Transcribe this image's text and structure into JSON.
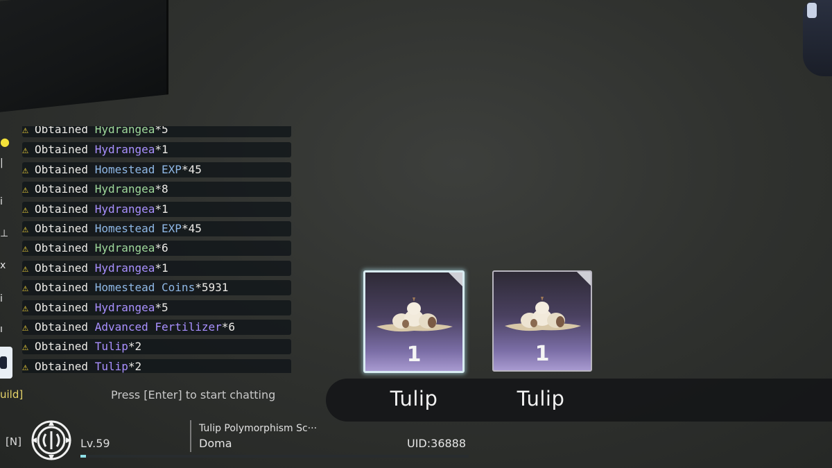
{
  "chat": {
    "hint": "Press [Enter] to start chatting",
    "guild_tag": "uild]",
    "lines": [
      {
        "prefix": "Obtained ",
        "item": "Hydrangea",
        "qty": "*5",
        "color": "green"
      },
      {
        "prefix": "Obtained ",
        "item": "Hydrangea",
        "qty": "*1",
        "color": "purple"
      },
      {
        "prefix": "Obtained ",
        "item": "Homestead EXP",
        "qty": "*45",
        "color": "blue"
      },
      {
        "prefix": "Obtained ",
        "item": "Hydrangea",
        "qty": "*8",
        "color": "green"
      },
      {
        "prefix": "Obtained ",
        "item": "Hydrangea",
        "qty": "*1",
        "color": "purple"
      },
      {
        "prefix": "Obtained ",
        "item": "Homestead EXP",
        "qty": "*45",
        "color": "blue"
      },
      {
        "prefix": "Obtained ",
        "item": "Hydrangea",
        "qty": "*6",
        "color": "green"
      },
      {
        "prefix": "Obtained ",
        "item": "Hydrangea",
        "qty": "*1",
        "color": "purple"
      },
      {
        "prefix": "Obtained ",
        "item": "Homestead Coins",
        "qty": "*5931",
        "color": "blue"
      },
      {
        "prefix": "Obtained ",
        "item": "Hydrangea",
        "qty": "*5",
        "color": "purple"
      },
      {
        "prefix": "Obtained ",
        "item": "Advanced Fertilizer",
        "qty": "*6",
        "color": "purple"
      },
      {
        "prefix": "Obtained ",
        "item": "Tulip",
        "qty": "*2",
        "color": "purple"
      },
      {
        "prefix": "Obtained ",
        "item": "Tulip",
        "qty": "*2",
        "color": "purple"
      }
    ]
  },
  "loot": {
    "items": [
      {
        "name": "Tulip",
        "count": "1",
        "selected": true
      },
      {
        "name": "Tulip",
        "count": "1",
        "selected": false
      }
    ]
  },
  "player": {
    "server_tag": "[N]",
    "level": "Lv.59",
    "quest_title": "Tulip Polymorphism Sc···",
    "location": "Doma",
    "uid": "UID:36888",
    "exp_fraction": 0.015
  },
  "colors": {
    "item_purple": "#a990ff",
    "item_green": "#9ed89a",
    "item_blue": "#8fb8e6",
    "warning_yellow": "#f2d43a",
    "selected_border": "#d8ecf2"
  },
  "icons": [
    "warning-icon",
    "guild-emblem-icon",
    "bulb-pile-icon",
    "notification-dot-icon"
  ]
}
